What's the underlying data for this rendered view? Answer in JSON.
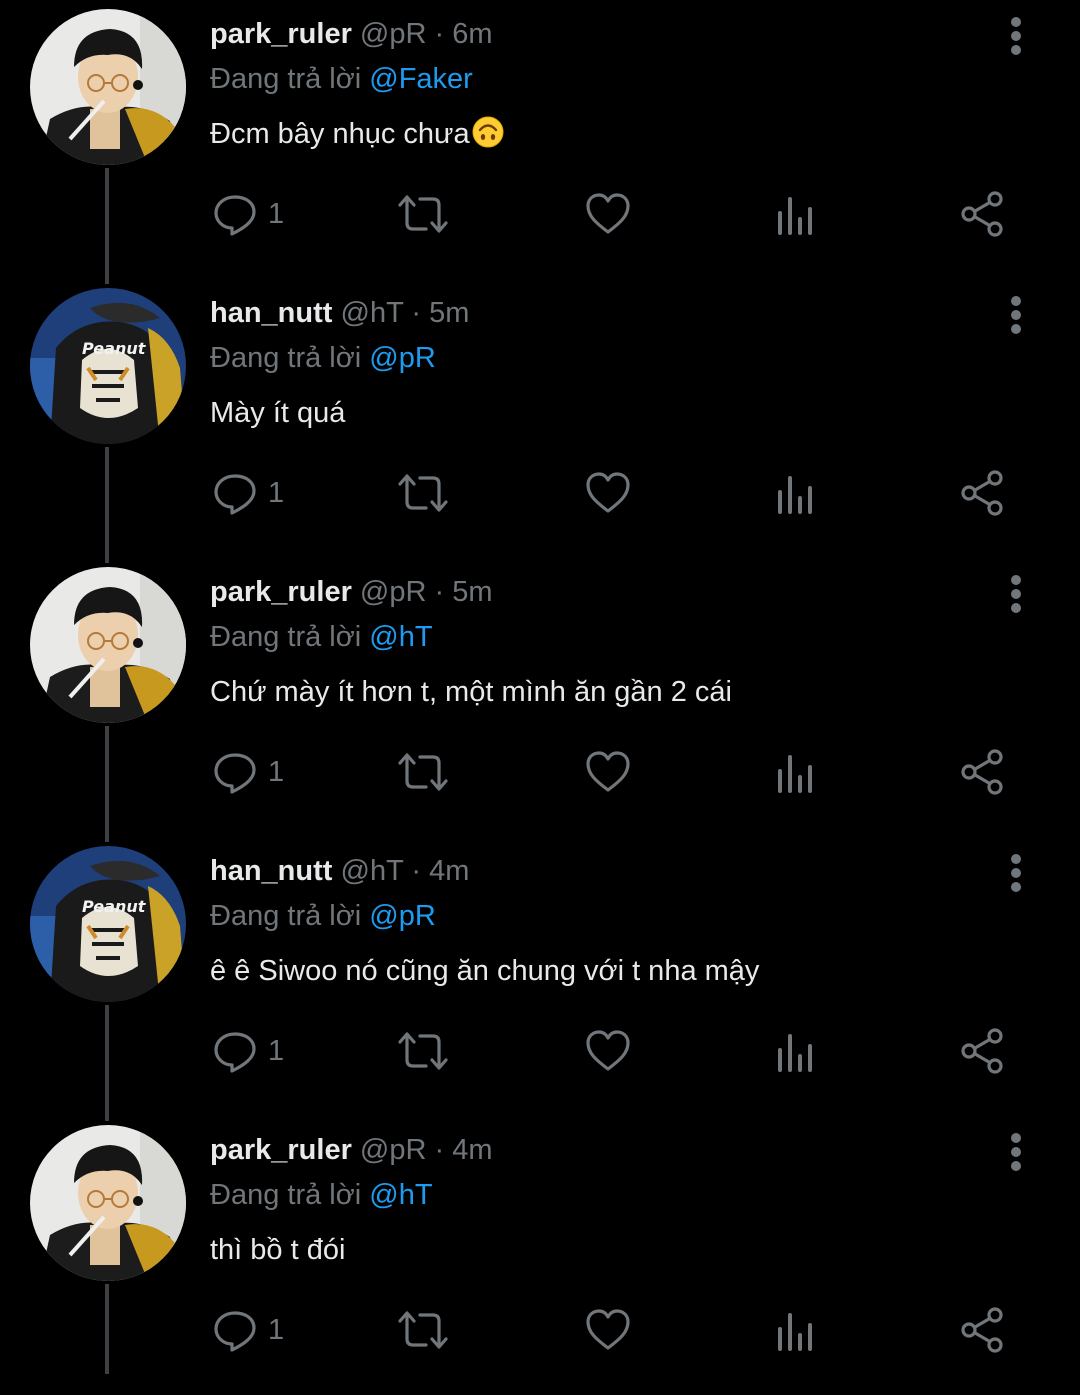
{
  "theme": {
    "background": "#000000",
    "text_primary": "#e7e9ea",
    "text_secondary": "#71767b",
    "accent": "#1d9bf0",
    "thread_line": "#3e4144"
  },
  "icons": {
    "reply": "reply-icon",
    "retweet": "retweet-icon",
    "like": "heart-icon",
    "views": "views-icon",
    "share": "share-icon",
    "more": "more-vertical-icon"
  },
  "tweets": [
    {
      "avatar": "park-ruler-avatar",
      "name": "park_ruler",
      "handle": "@pR",
      "separator": "·",
      "time": "6m",
      "reply_prefix": "Đang trả lời",
      "reply_to": "@Faker",
      "text": "Đcm bây nhục chưa",
      "emoji": "upside-down-face",
      "reply_count": "1"
    },
    {
      "avatar": "han-nutt-avatar",
      "name": "han_nutt",
      "handle": "@hT",
      "separator": "·",
      "time": "5m",
      "reply_prefix": "Đang trả lời",
      "reply_to": "@pR",
      "text": "Mày ít quá",
      "reply_count": "1"
    },
    {
      "avatar": "park-ruler-avatar",
      "name": "park_ruler",
      "handle": "@pR",
      "separator": "·",
      "time": "5m",
      "reply_prefix": "Đang trả lời",
      "reply_to": "@hT",
      "text": "Chứ mày ít hơn t, một mình ăn gần 2 cái",
      "reply_count": "1"
    },
    {
      "avatar": "han-nutt-avatar",
      "name": "han_nutt",
      "handle": "@hT",
      "separator": "·",
      "time": "4m",
      "reply_prefix": "Đang trả lời",
      "reply_to": "@pR",
      "text": "ê ê Siwoo nó cũng ăn chung với t nha mậy",
      "reply_count": "1"
    },
    {
      "avatar": "park-ruler-avatar",
      "name": "park_ruler",
      "handle": "@pR",
      "separator": "·",
      "time": "4m",
      "reply_prefix": "Đang trả lời",
      "reply_to": "@hT",
      "text": "thì bồ t đói",
      "reply_count": "1"
    }
  ]
}
